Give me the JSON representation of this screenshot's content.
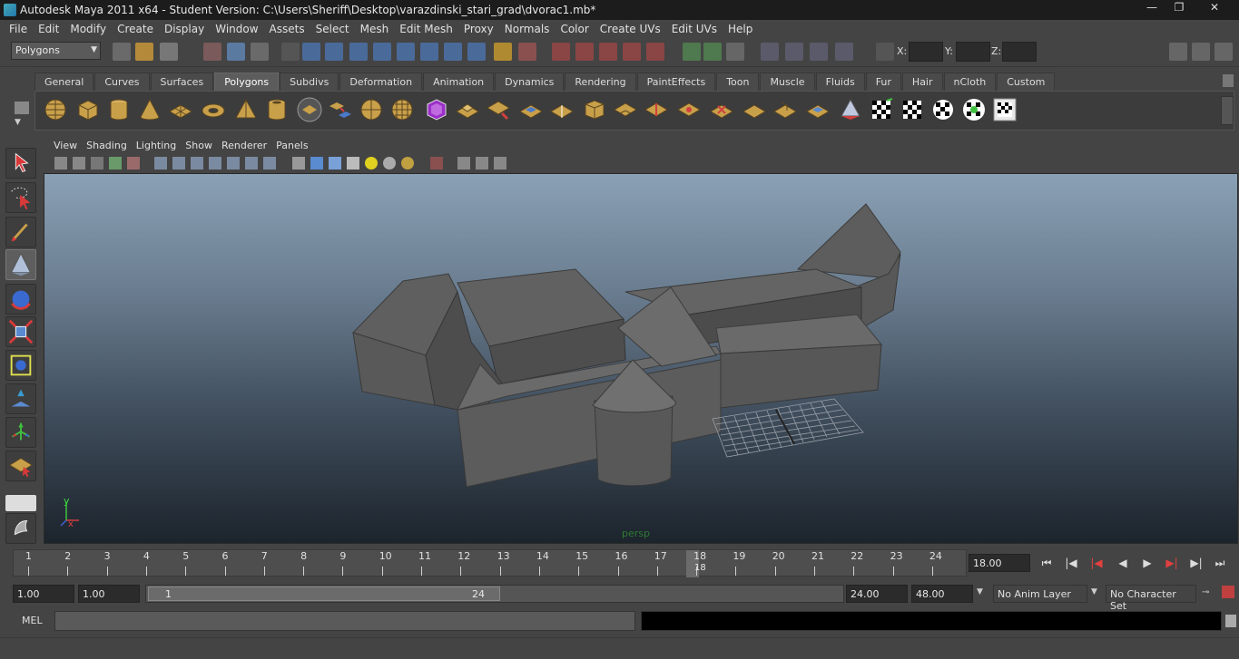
{
  "window": {
    "title": "Autodesk Maya 2011 x64 - Student Version: C:\\Users\\Sheriff\\Desktop\\varazdinski_stari_grad\\dvorac1.mb*",
    "minimize": "—",
    "maximize": "❐",
    "close": "✕"
  },
  "menubar": [
    "File",
    "Edit",
    "Modify",
    "Create",
    "Display",
    "Window",
    "Assets",
    "Select",
    "Mesh",
    "Edit Mesh",
    "Proxy",
    "Normals",
    "Color",
    "Create UVs",
    "Edit UVs",
    "Help"
  ],
  "statusline": {
    "mode": "Polygons",
    "x_label": "X:",
    "y_label": "Y:",
    "z_label": "Z:",
    "x_value": "",
    "y_value": "",
    "z_value": ""
  },
  "shelf": {
    "tabs": [
      "General",
      "Curves",
      "Surfaces",
      "Polygons",
      "Subdivs",
      "Deformation",
      "Animation",
      "Dynamics",
      "Rendering",
      "PaintEffects",
      "Toon",
      "Muscle",
      "Fluids",
      "Fur",
      "Hair",
      "nCloth",
      "Custom"
    ],
    "active_tab": "Polygons"
  },
  "viewport": {
    "menus": [
      "View",
      "Shading",
      "Lighting",
      "Show",
      "Renderer",
      "Panels"
    ],
    "camera": "persp",
    "axis_y": "y",
    "axis_x": "x",
    "axis_z": "z"
  },
  "timeslider": {
    "ticks": [
      "1",
      "2",
      "3",
      "4",
      "5",
      "6",
      "7",
      "8",
      "9",
      "10",
      "11",
      "12",
      "13",
      "14",
      "15",
      "16",
      "17",
      "18",
      "19",
      "20",
      "21",
      "22",
      "23",
      "24"
    ],
    "current_frame": "18",
    "current_time": "18.00"
  },
  "range": {
    "start_time": "1.00",
    "playback_start": "1.00",
    "range_start": "1",
    "range_end": "24",
    "playback_end": "24.00",
    "end_time": "48.00",
    "anim_layer": "No Anim Layer",
    "character_set": "No Character Set"
  },
  "command": {
    "label": "MEL",
    "input": "",
    "output": ""
  },
  "help": {
    "text": ""
  }
}
